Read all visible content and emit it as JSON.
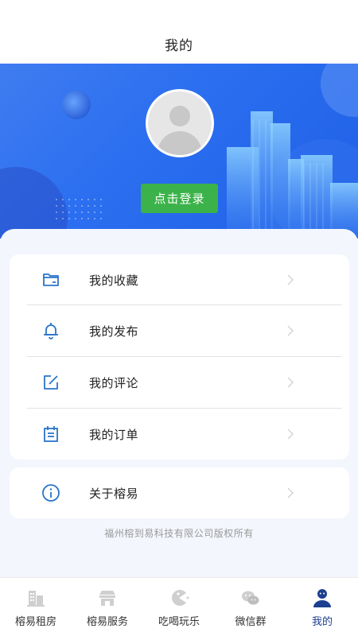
{
  "header": {
    "title": "我的"
  },
  "profile": {
    "login_label": "点击登录"
  },
  "menu": [
    {
      "label": "我的收藏",
      "icon": "folder-icon"
    },
    {
      "label": "我的发布",
      "icon": "bell-icon"
    },
    {
      "label": "我的评论",
      "icon": "edit-icon"
    },
    {
      "label": "我的订单",
      "icon": "order-icon"
    }
  ],
  "about": {
    "label": "关于榕易",
    "icon": "info-icon"
  },
  "footer": {
    "copyright": "福州榕到易科技有限公司版权所有"
  },
  "tabbar": [
    {
      "label": "榕易租房",
      "icon": "building-icon",
      "active": false
    },
    {
      "label": "榕易服务",
      "icon": "shop-icon",
      "active": false
    },
    {
      "label": "吃喝玩乐",
      "icon": "pacman-icon",
      "active": false
    },
    {
      "label": "微信群",
      "icon": "wechat-icon",
      "active": false
    },
    {
      "label": "我的",
      "icon": "user-icon",
      "active": true
    }
  ],
  "colors": {
    "accent": "#2c6ff0",
    "login_button": "#3cb34a",
    "icon_blue": "#2a74c9",
    "active_tab": "#1d3f8f",
    "inactive_tab_icon": "#cfcfcf"
  }
}
